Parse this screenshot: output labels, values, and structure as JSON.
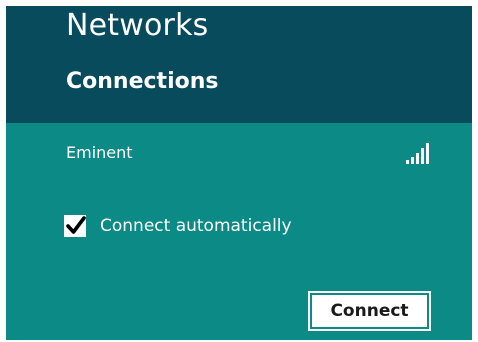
{
  "header": {
    "title": "Networks",
    "subtitle": "Connections"
  },
  "network": {
    "name": "Eminent",
    "signal_bars": 5,
    "signal_strength": 5
  },
  "options": {
    "connect_automatically_label": "Connect automatically",
    "connect_automatically_checked": true
  },
  "actions": {
    "connect_label": "Connect"
  },
  "colors": {
    "header_bg": "#074b5c",
    "panel_bg": "#0b8a86",
    "text": "#ffffff"
  }
}
